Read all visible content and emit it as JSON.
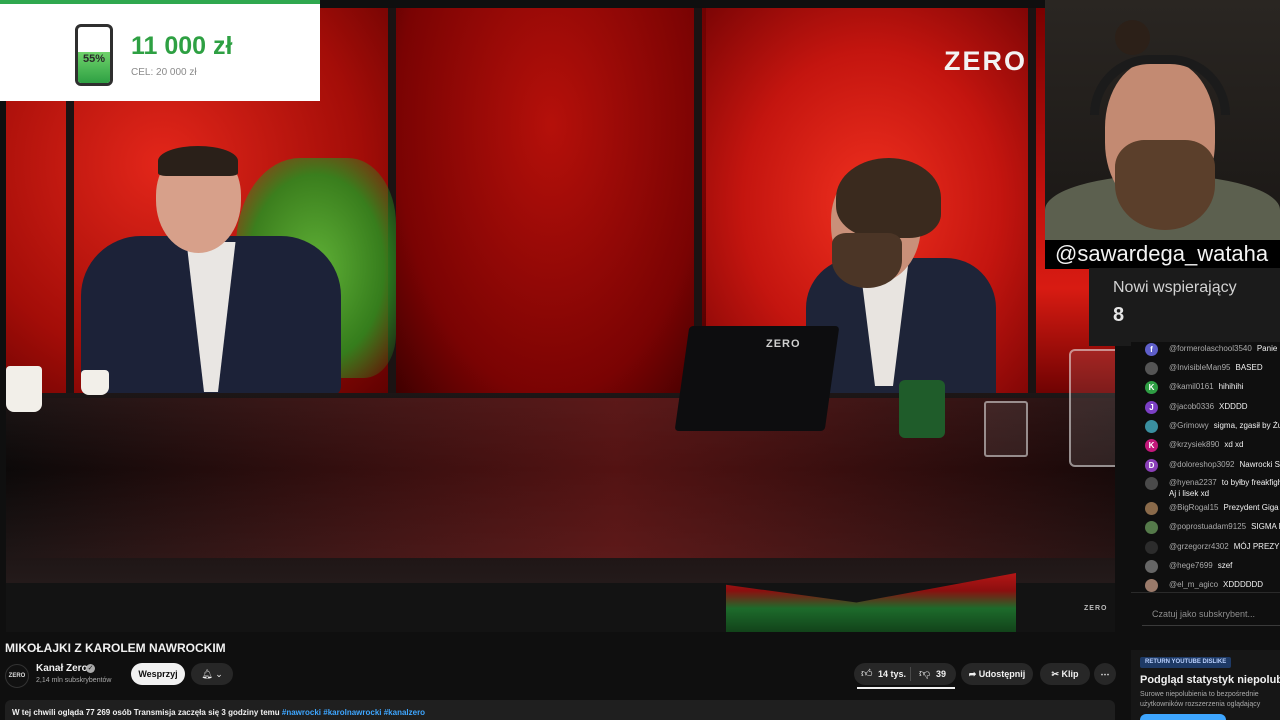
{
  "donation": {
    "percent": 55,
    "percent_label": "55%",
    "amount": "11 000 zł",
    "goal": "CEL: 20 000 zł",
    "accent_color": "#2ea043"
  },
  "video": {
    "watermark": "ZERO",
    "laptop_logo": "ZERO",
    "corner_logo": "ZERO"
  },
  "streamer": {
    "handle": "@sawardega_wataha",
    "supporters_label": "Nowi wspierający",
    "supporters_count": "8"
  },
  "chat": {
    "messages": [
      {
        "user": "@formerolaschool3540",
        "text": "Panie p",
        "avatar": "f",
        "color": "#5e5ec9"
      },
      {
        "user": "@InvisibleMan95",
        "text": "BASED",
        "avatar": "",
        "color": "#555555"
      },
      {
        "user": "@kamil0161",
        "text": "hihihihi",
        "avatar": "K",
        "color": "#2f9e44"
      },
      {
        "user": "@jacob0336",
        "text": "XDDDD",
        "avatar": "J",
        "color": "#7b3fc4"
      },
      {
        "user": "@Grimowy",
        "text": "sigma, zgasił by Żu",
        "avatar": "",
        "color": "#3a8fa0"
      },
      {
        "user": "@krzysiek890",
        "text": "xd xd",
        "avatar": "K",
        "color": "#c2187a"
      },
      {
        "user": "@doloreshop3092",
        "text": "Nawrocki S",
        "avatar": "D",
        "color": "#8a3fb8"
      },
      {
        "user": "@hyena2237",
        "text": "to byłby freakfigh",
        "text2": "Aj i lisek xd",
        "avatar": "",
        "color": "#4a4a4a"
      },
      {
        "user": "@BigRogal15",
        "text": "Prezydent Giga C",
        "avatar": "",
        "color": "#8a6a4a"
      },
      {
        "user": "@poprostuadam9125",
        "text": "SIGMA N",
        "avatar": "",
        "color": "#557a4a"
      },
      {
        "user": "@grzegorzr4302",
        "text": "MÓJ PREZYD",
        "avatar": "",
        "color": "#2c2c2c"
      },
      {
        "user": "@hege7699",
        "text": "szef",
        "avatar": "",
        "color": "#666666"
      },
      {
        "user": "@el_m_agico",
        "text": "XDDDDDD",
        "avatar": "",
        "color": "#9a7a6a"
      }
    ],
    "input_placeholder": "Czatuj jako subskrybent..."
  },
  "below": {
    "title": "MIKOŁAJKI Z KAROLEM NAWROCKIM",
    "channel_logo": "ZERO",
    "channel_name": "Kanał Zero",
    "subscribers": "2,14 mln subskrybentów",
    "support_button": "Wesprzyj",
    "likes": "14 tys.",
    "dislikes": "39",
    "share": "Udostępnij",
    "clip": "Klip",
    "live_info": "W tej chwili ogląda 77 269 osób  Transmisja zaczęła się 3 godziny temu",
    "hashtags": "#nawrocki #karolnawrocki #kanalzero"
  },
  "ryd": {
    "badge": "RETURN YOUTUBE DISLIKE",
    "title": "Podgląd statystyk niepolubie",
    "line1": "Surowe niepolubienia to bezpośrednie",
    "line2": "użytkowników rozszerzenia oglądający"
  }
}
